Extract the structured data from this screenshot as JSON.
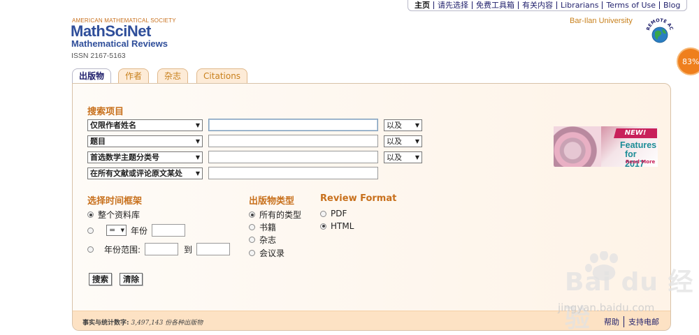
{
  "topnav": {
    "items": [
      "主页",
      "请先选择",
      "免费工具箱",
      "有关内容",
      "Librarians",
      "Terms of Use",
      "Blog"
    ]
  },
  "logo": {
    "org": "AMERICAN MATHEMATICAL SOCIETY",
    "name": "MathSciNet",
    "subtitle": "Mathematical Reviews",
    "issn": "ISSN 2167-5163"
  },
  "header": {
    "institution": "Bar-Ilan University",
    "remote_access_label": "REMOTE ACCESS",
    "progress_badge": "83%"
  },
  "tabs": [
    {
      "label": "出版物",
      "active": true
    },
    {
      "label": "作者",
      "active": false
    },
    {
      "label": "杂志",
      "active": false
    },
    {
      "label": "Citations",
      "active": false
    }
  ],
  "search": {
    "title": "搜索项目",
    "rows": [
      {
        "field": "仅限作者姓名",
        "value": "",
        "operator": "以及"
      },
      {
        "field": "题目",
        "value": "",
        "operator": "以及"
      },
      {
        "field": "首选数学主题分类号",
        "value": "",
        "operator": "以及"
      },
      {
        "field": "在所有文献或评论原文某处",
        "value": "",
        "operator": ""
      }
    ]
  },
  "promo": {
    "badge": "NEW!",
    "line1": "Features",
    "line2": "for 2017",
    "more": "Read More"
  },
  "time_frame": {
    "title": "选择时间框架",
    "option_all": "整个资料库",
    "equals_operator": "=",
    "year_label": "年份",
    "range_label": "年份范围:",
    "range_to": "到",
    "selected": "all"
  },
  "pub_type": {
    "title": "出版物类型",
    "options": [
      "所有的类型",
      "书籍",
      "杂志",
      "会议录"
    ],
    "selected": 0
  },
  "review_format": {
    "title": "Review Format",
    "options": [
      "PDF",
      "HTML"
    ],
    "selected": 1
  },
  "buttons": {
    "search": "搜索",
    "clear": "清除"
  },
  "footer": {
    "stats_label": "事实与统计数字:",
    "stats_count": "3,497,143",
    "stats_suffix": "份各种出版物",
    "help": "帮助",
    "support": "支持电邮"
  },
  "watermark": {
    "brand": "Bai du 经验",
    "url": "jingyan.baidu.com"
  },
  "colors": {
    "accent_orange": "#c8701c",
    "brand_blue": "#2f4e9a",
    "promo_pink": "#c8205a",
    "promo_teal": "#1c8c96"
  }
}
